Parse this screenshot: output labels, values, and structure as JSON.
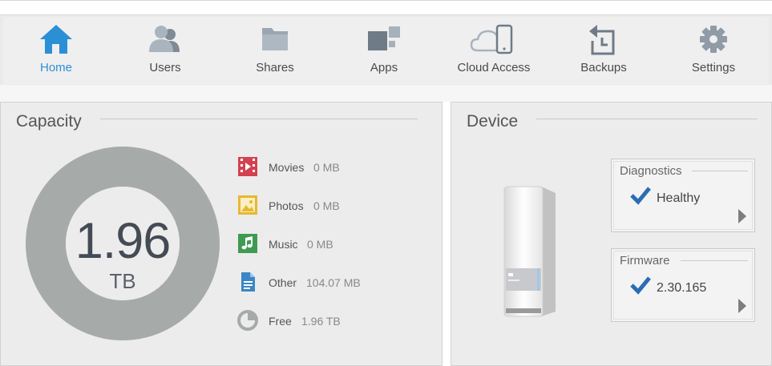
{
  "nav": {
    "items": [
      {
        "label": "Home",
        "icon": "home-icon",
        "active": true
      },
      {
        "label": "Users",
        "icon": "users-icon"
      },
      {
        "label": "Shares",
        "icon": "folder-icon"
      },
      {
        "label": "Apps",
        "icon": "apps-icon"
      },
      {
        "label": "Cloud Access",
        "icon": "cloud-device-icon"
      },
      {
        "label": "Backups",
        "icon": "backup-clock-icon"
      },
      {
        "label": "Settings",
        "icon": "gear-icon"
      }
    ],
    "active_color": "#2b8fd6",
    "icon_color": "#9aa6b2"
  },
  "capacity": {
    "title": "Capacity",
    "total_value": "1.96",
    "total_unit": "TB",
    "donut_color": "#a6aba9",
    "categories": [
      {
        "name": "Movies",
        "value": "0 MB",
        "icon": "film-icon",
        "color": "#d2424f"
      },
      {
        "name": "Photos",
        "value": "0 MB",
        "icon": "photo-icon",
        "color": "#e6b832"
      },
      {
        "name": "Music",
        "value": "0 MB",
        "icon": "music-icon",
        "color": "#3f9a52"
      },
      {
        "name": "Other",
        "value": "104.07 MB",
        "icon": "document-icon",
        "color": "#3b86c4"
      },
      {
        "name": "Free",
        "value": "1.96 TB",
        "icon": "pie-icon",
        "color": "#a6aba9"
      }
    ]
  },
  "device": {
    "title": "Device",
    "device_image": "nas-drive-image",
    "diagnostics": {
      "title": "Diagnostics",
      "status": "Healthy"
    },
    "firmware": {
      "title": "Firmware",
      "version": "2.30.165"
    },
    "check_color": "#2a6db3"
  }
}
